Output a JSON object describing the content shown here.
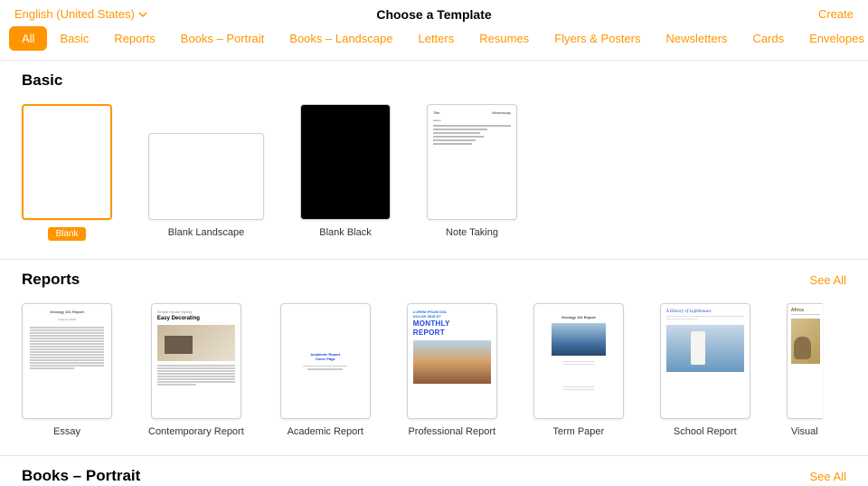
{
  "header": {
    "language": "English (United States)",
    "title": "Choose a Template",
    "create": "Create"
  },
  "tabs": [
    "All",
    "Basic",
    "Reports",
    "Books – Portrait",
    "Books – Landscape",
    "Letters",
    "Resumes",
    "Flyers & Posters",
    "Newsletters",
    "Cards",
    "Envelopes"
  ],
  "active_tab": 0,
  "sections": {
    "basic": {
      "title": "Basic",
      "items": [
        {
          "label": "Blank",
          "selected": true
        },
        {
          "label": "Blank Landscape"
        },
        {
          "label": "Blank Black"
        },
        {
          "label": "Note Taking"
        }
      ]
    },
    "reports": {
      "title": "Reports",
      "see_all": "See All",
      "items": [
        {
          "label": "Essay",
          "thumb_title": "Geology 101 Report"
        },
        {
          "label": "Contemporary Report",
          "thumb_sub": "Simple House Styling",
          "thumb_title": "Easy Decorating"
        },
        {
          "label": "Academic Report",
          "thumb_t1": "Academic Report",
          "thumb_t2": "Cover Page"
        },
        {
          "label": "Professional Report",
          "thumb_big1": "MONTHLY",
          "thumb_big2": "REPORT"
        },
        {
          "label": "Term Paper",
          "thumb_title": "Geology 101 Report"
        },
        {
          "label": "School Report",
          "thumb_title": "A History of Lighthouses"
        },
        {
          "label": "Visual",
          "thumb_title": "Africa"
        }
      ]
    },
    "books_portrait": {
      "title": "Books – Portrait",
      "see_all": "See All"
    }
  }
}
